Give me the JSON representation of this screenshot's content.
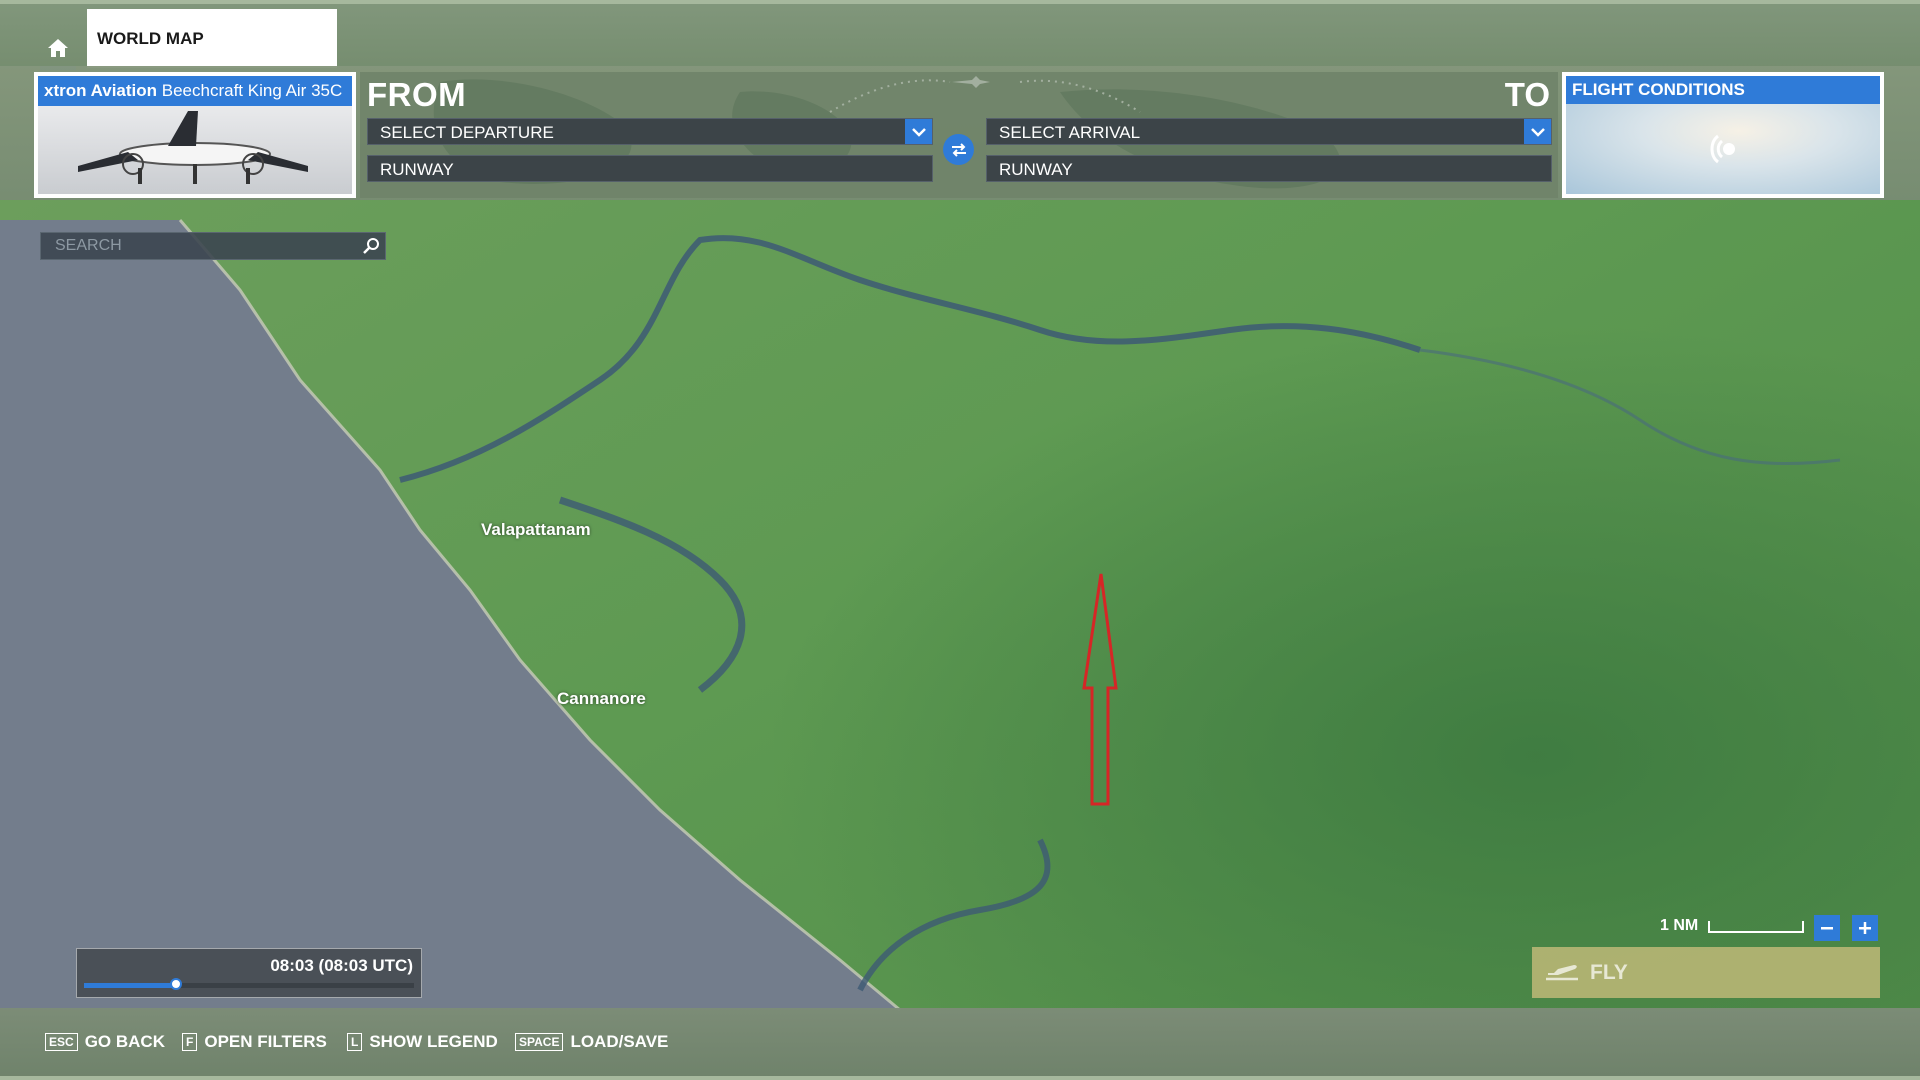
{
  "header": {
    "tab_title": "WORLD MAP"
  },
  "aircraft": {
    "manufacturer": "xtron Aviation",
    "model": "Beechcraft King Air 35C"
  },
  "route": {
    "from_label": "FROM",
    "to_label": "TO",
    "departure_placeholder": "SELECT DEPARTURE",
    "arrival_placeholder": "SELECT ARRIVAL",
    "departure_runway": "RUNWAY",
    "arrival_runway": "RUNWAY"
  },
  "conditions": {
    "title": "FLIGHT CONDITIONS"
  },
  "search": {
    "placeholder": "SEARCH"
  },
  "map": {
    "labels": [
      "Valapattanam",
      "Cannanore"
    ]
  },
  "time": {
    "display": "08:03 (08:03 UTC)",
    "slider_fraction": 0.28
  },
  "scale": {
    "label": "1 NM"
  },
  "fly": {
    "label": "FLY"
  },
  "hints": [
    {
      "key": "ESC",
      "label": "GO BACK"
    },
    {
      "key": "F",
      "label": "OPEN FILTERS"
    },
    {
      "key": "L",
      "label": "SHOW LEGEND"
    },
    {
      "key": "SPACE",
      "label": "LOAD/SAVE"
    }
  ],
  "colors": {
    "accent": "#2f7bd8",
    "land": "#5f9a57",
    "sea": "#737d8c",
    "marker": "#d62626"
  },
  "icons": {
    "home": "home-icon",
    "dropdown": "chevron-down-icon",
    "swap": "swap-arrows-icon",
    "weather": "weather-icon",
    "search": "search-icon",
    "fly": "airplane-takeoff-icon",
    "marker": "red-arrow-marker"
  }
}
